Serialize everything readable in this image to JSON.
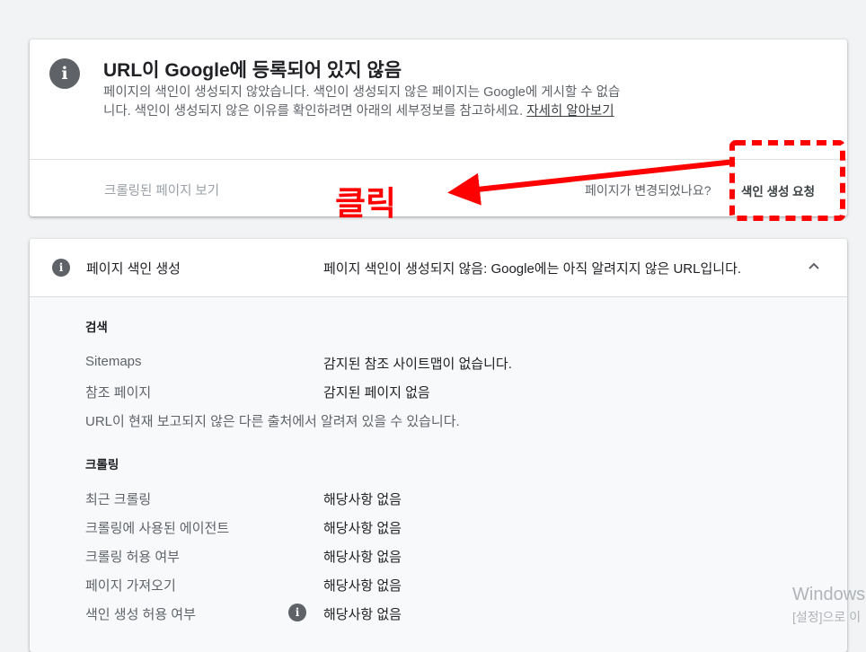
{
  "colors": {
    "background": "#f1f3f4",
    "accent_annotation": "#ff0000",
    "muted_text": "#5f6368",
    "info_icon": "#5f6368"
  },
  "status_card": {
    "icon": "info-icon",
    "title": "URL이 Google에 등록되어 있지 않음",
    "description": "페이지의 색인이 생성되지 않았습니다. 색인이 생성되지 않은 페이지는 Google에 게시할 수 없습니다. 색인이 생성되지 않은 이유를 확인하려면 아래의 세부정보를 참고하세요. ",
    "learn_more": "자세히 알아보기",
    "crawled_page_link": "크롤링된 페이지 보기",
    "changed_question": "페이지가 변경되었나요?",
    "request_indexing": "색인 생성 요청"
  },
  "coverage_card": {
    "icon": "info-icon",
    "label": "페이지 색인 생성",
    "value": "페이지 색인이 생성되지 않음: Google에는 아직 알려지지 않은 URL입니다.",
    "expand_icon": "chevron-up-icon",
    "discovery": {
      "title": "검색",
      "rows": [
        {
          "label": "Sitemaps",
          "value": "감지된 참조 사이트맵이 없습니다."
        },
        {
          "label": "참조 페이지",
          "value": "감지된 페이지 없음"
        }
      ],
      "note": "URL이 현재 보고되지 않은 다른 출처에서 알려져 있을 수 있습니다."
    },
    "crawl": {
      "title": "크롤링",
      "rows": [
        {
          "label": "최근 크롤링",
          "value": "해당사항 없음"
        },
        {
          "label": "크롤링에 사용된 에이전트",
          "value": "해당사항 없음"
        },
        {
          "label": "크롤링 허용 여부",
          "value": "해당사항 없음"
        },
        {
          "label": "페이지 가져오기",
          "value": "해당사항 없음"
        },
        {
          "label": "색인 생성 허용 여부",
          "value": "해당사항 없음"
        }
      ]
    }
  },
  "annotation": {
    "click_text": "클릭"
  },
  "watermark": {
    "line1": "Windows",
    "line2": "[설정]으로 이"
  }
}
